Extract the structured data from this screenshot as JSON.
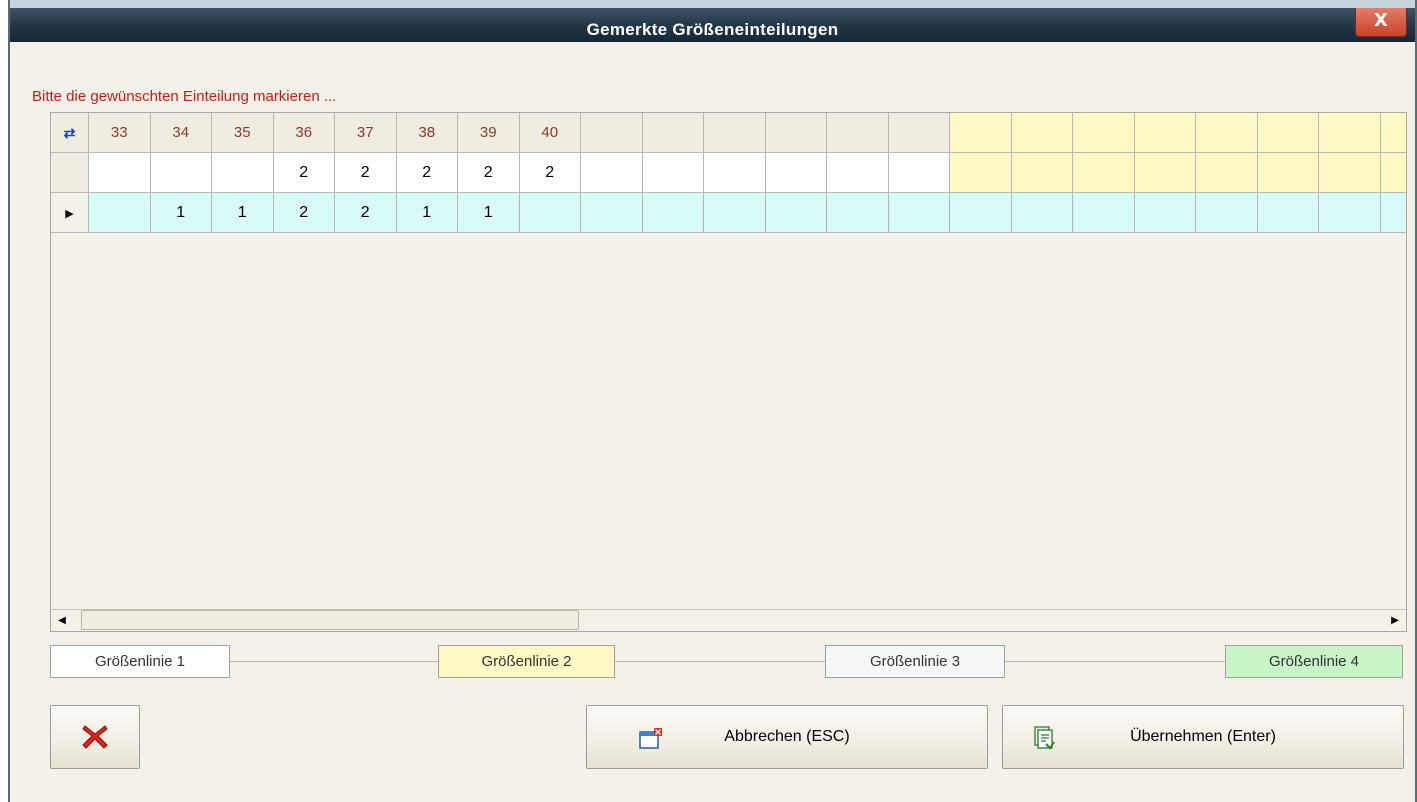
{
  "window": {
    "title": "Gemerkte Größeneinteilungen",
    "close_label": "X"
  },
  "hint": "Bitte die gewünschten Einteilung markieren ...",
  "grid": {
    "columns": [
      "33",
      "34",
      "35",
      "36",
      "37",
      "38",
      "39",
      "40",
      "",
      "",
      "",
      "",
      "",
      "",
      "",
      "",
      "",
      "",
      "",
      "",
      "",
      ""
    ],
    "yellow_from_column": 14,
    "rows": [
      [
        "",
        "",
        "",
        "2",
        "2",
        "2",
        "2",
        "2",
        "",
        "",
        "",
        "",
        "",
        "",
        "",
        "",
        "",
        "",
        "",
        "",
        "",
        ""
      ],
      [
        "",
        "1",
        "1",
        "2",
        "2",
        "1",
        "1",
        "",
        "",
        "",
        "",
        "",
        "",
        "",
        "",
        "",
        "",
        "",
        "",
        "",
        "",
        ""
      ]
    ],
    "row_colors": {
      "header": "#efece2",
      "row1": "#ffffff",
      "row2": "#d9fbf8",
      "yellow": "#fff9c4"
    }
  },
  "legend": [
    {
      "label": "Größenlinie 1",
      "color": "#ffffff"
    },
    {
      "label": "Größenlinie 2",
      "color": "#fff9c4"
    },
    {
      "label": "Größenlinie 3",
      "color": "#f7f7f7"
    },
    {
      "label": "Größenlinie 4",
      "color": "#c8f5c8"
    }
  ],
  "buttons": {
    "delete_icon": "red-x-icon",
    "cancel": "Abbrechen (ESC)",
    "cancel_icon": "window-close-icon",
    "apply": "Übernehmen (Enter)",
    "apply_icon": "apply-document-icon"
  }
}
